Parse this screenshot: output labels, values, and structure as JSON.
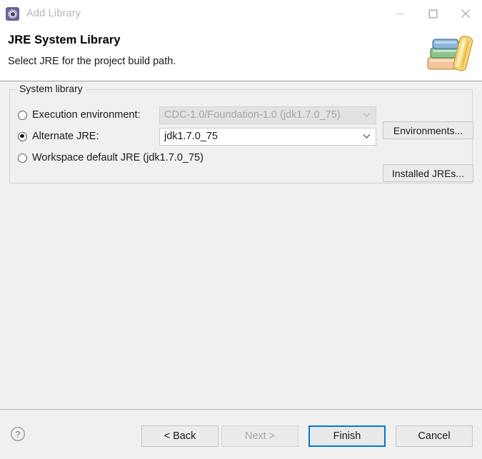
{
  "window": {
    "icon_name": "eclipse-gear-icon",
    "title": "Add Library",
    "controls": {
      "minimize_label": "Minimize",
      "maximize_label": "Maximize",
      "close_label": "Close"
    }
  },
  "header": {
    "title": "JRE System Library",
    "subtitle": "Select JRE for the project build path.",
    "graphic_name": "books-stack-icon"
  },
  "group": {
    "legend": "System library",
    "rows": {
      "execution_environment": {
        "label": "Execution environment:",
        "selected": false,
        "combo_value": "CDC-1.0/Foundation-1.0 (jdk1.7.0_75)",
        "combo_enabled": false,
        "button_label": "Environments..."
      },
      "alternate_jre": {
        "label": "Alternate JRE:",
        "selected": true,
        "combo_value": "jdk1.7.0_75",
        "combo_enabled": true,
        "button_label": "Installed JREs..."
      },
      "workspace_default": {
        "label": "Workspace default JRE (jdk1.7.0_75)",
        "selected": false
      }
    }
  },
  "footer": {
    "help_label": "?",
    "buttons": {
      "back": "< Back",
      "next": "Next >",
      "finish": "Finish",
      "cancel": "Cancel"
    }
  },
  "colors": {
    "accent": "#0078d7",
    "title_bar_bg": "#ffffff",
    "body_bg": "#f0f0f0",
    "disabled_text": "#a6a6a6",
    "title_text": "#b5b5b5"
  }
}
